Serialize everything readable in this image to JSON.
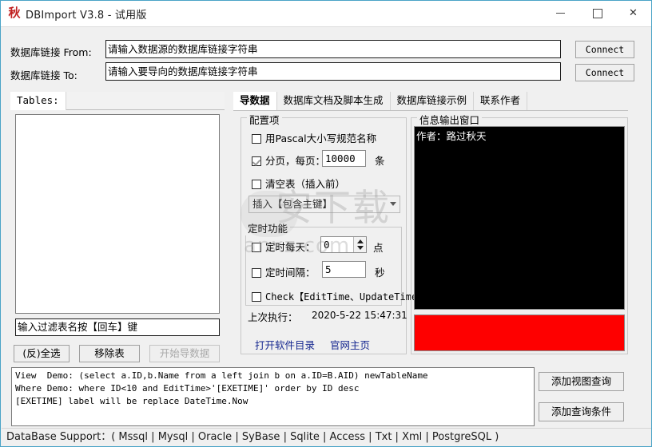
{
  "titlebar": {
    "icon_glyph": "秋",
    "title": "DBImport V3.8 - 试用版",
    "minimize_label": "",
    "maximize_label": "",
    "close_label": "✕"
  },
  "connection": {
    "from_label": "数据库链接 From:",
    "from_value": "请输入数据源的数据库链接字符串",
    "to_label": "数据库链接 To:",
    "to_value": "请输入要导向的数据库链接字符串",
    "connect_from_button": "Connect",
    "connect_to_button": "Connect"
  },
  "left_panel": {
    "tab_label": "Tables:",
    "list_items": [],
    "filter_value": "输入过滤表名按【回车】键",
    "buttons": [
      {
        "label": "(反)全选",
        "disabled": false
      },
      {
        "label": "移除表",
        "disabled": false
      },
      {
        "label": "开始导数据",
        "disabled": true
      }
    ]
  },
  "main_tabs": [
    {
      "label": "导数据",
      "active": true
    },
    {
      "label": "数据库文档及脚本生成",
      "active": false
    },
    {
      "label": "数据库链接示例",
      "active": false
    },
    {
      "label": "联系作者",
      "active": false
    }
  ],
  "config_group": {
    "title": "配置项",
    "pascal_checkbox": {
      "label": "用Pascal大小写规范名称",
      "checked": false
    },
    "paging_checkbox": {
      "label_prefix": "分页，每页：",
      "checked": true,
      "value": "10000",
      "unit": "条"
    },
    "truncate_checkbox": {
      "label": "清空表（插入前）",
      "checked": false
    },
    "insert_mode_combo": {
      "value": "插入【包含主键】"
    },
    "timer_group_title": "定时功能",
    "daily_checkbox": {
      "label": "定时每天：",
      "checked": false,
      "value": "0",
      "unit": "点"
    },
    "interval_checkbox": {
      "label": "定时间隔：",
      "checked": false,
      "value": "5",
      "unit": "秒"
    },
    "check_edittime_checkbox": {
      "label": "Check【EditTime、UpdateTime】",
      "checked": false
    },
    "last_run_label": "上次执行：",
    "last_run_value": "2020-5-22 15:47:31",
    "open_dir_link": "打开软件目录",
    "homepage_link": "官网主页"
  },
  "output_group": {
    "title": "信息输出窗口",
    "console_text": "作者：路过秋天",
    "alert_color": "#fe0000"
  },
  "sql_area": {
    "lines": [
      "View  Demo: (select a.ID,b.Name from a left join b on a.ID=B.AID) newTableName",
      "Where Demo: where ID<10 and EditTime>'[EXETIME]' order by ID desc",
      "[EXETIME] label will be replace DateTime.Now"
    ]
  },
  "right_buttons": [
    {
      "label": "添加视图查询"
    },
    {
      "label": "添加查询条件"
    }
  ],
  "statusbar": {
    "text": "DataBase Support：( Mssql | Mysql | Oracle | SyBase | Sqlite | Access | Txt | Xml | PostgreSQL )"
  },
  "watermark": {
    "big": "安下载",
    "small": "anxz.com"
  }
}
